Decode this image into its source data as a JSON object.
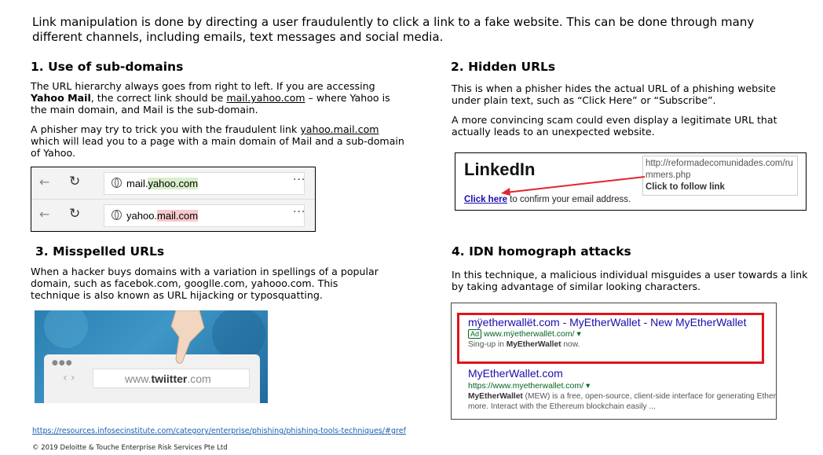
{
  "intro": "Link manipulation is done by directing a user fraudulently to click a link to a fake website. This can be done through many different channels, including emails, text messages and social media.",
  "s1": {
    "heading": "1. Use of sub-domains",
    "p1a": "The URL hierarchy always goes from right to left. If you are accessing ",
    "p1b": "Yahoo Mail",
    "p1c": ", the correct link should be ",
    "p1link": "mail.yahoo.com",
    "p1d": " – where Yahoo is the main domain, and Mail is the sub-domain.",
    "p2a": "A phisher may try to trick you with the fraudulent link ",
    "p2link": "yahoo.mail.com",
    "p2b": " which will lead you to a page with a main domain of Mail and a sub-domain of Yahoo.",
    "bar1": {
      "pre": "mail.",
      "hl": "yahoo.com"
    },
    "bar2": {
      "pre": "yahoo.",
      "hl": "mail.com"
    }
  },
  "s2": {
    "heading": "2. Hidden URLs",
    "p1": "This is when a phisher hides the actual URL of a phishing website under plain text, such as “Click Here” or “Subscribe”.",
    "p2": "A more convincing scam could even display a legitimate URL that actually leads to an unexpected website.",
    "brand": "LinkedIn",
    "tip_url": "http://reformadecomunidades.com/rummers.php",
    "tip_action": "Click to follow link",
    "click": "Click here",
    "click_rest": " to confirm your email address."
  },
  "s3": {
    "heading": "3. Misspelled URLs",
    "p1": "When a hacker buys domains with a variation in spellings of a popular domain, such as facebok.com, googlle.com, yahooo.com. This technique is also known as URL hijacking or typosquatting.",
    "url_pre": "www.",
    "url_bold": "twiitter",
    "url_post": ".com"
  },
  "s4": {
    "heading": "4. IDN homograph attacks",
    "p1": "In this technique, a malicious individual misguides a user towards a link by taking advantage of similar looking characters.",
    "r1_title": "mÿetherwallët.com - MyEtherWallet - New MyEtherWallet",
    "r1_ad": "Ad",
    "r1_url": "www.mÿetherwallët.com/ ▾",
    "r1_snip_a": "Sing-up in ",
    "r1_snip_b": "MyEtherWallet",
    "r1_snip_c": " now.",
    "r2_title": "MyEtherWallet.com",
    "r2_url": "https://www.myetherwallet.com/ ▾",
    "r2_snip1_b": "MyEtherWallet",
    "r2_snip1": " (MEW) is a free, open-source, client-side interface for generating Ethere",
    "r2_snip2": "more. Interact with the Ethereum blockchain easily ..."
  },
  "source": "https://resources.infosecinstitute.com/category/enterprise/phishing/phishing-tools-techniques/#gref",
  "copyright": "© 2019 Deloitte & Touche Enterprise Risk Services Pte Ltd"
}
